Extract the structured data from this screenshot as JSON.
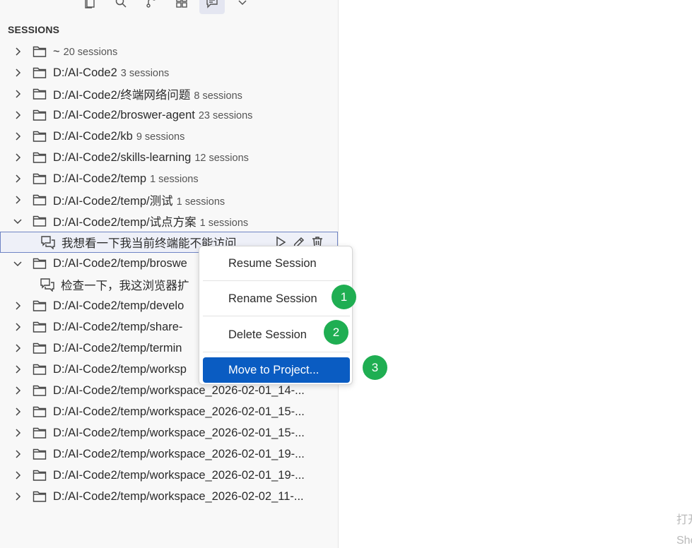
{
  "toolbar": {
    "icons": [
      "explorer-icon",
      "search-icon",
      "source-control-icon",
      "extensions-icon",
      "chat-sessions-icon",
      "chevron-down-icon"
    ]
  },
  "sidebar": {
    "title": "SESSIONS",
    "rows": [
      {
        "label": "~",
        "count": "20 sessions",
        "expanded": false
      },
      {
        "label": "D:/AI-Code2",
        "count": "3 sessions",
        "expanded": false
      },
      {
        "label": "D:/AI-Code2/终端网络问题",
        "count": "8 sessions",
        "expanded": false
      },
      {
        "label": "D:/AI-Code2/broswer-agent",
        "count": "23 sessions",
        "expanded": false
      },
      {
        "label": "D:/AI-Code2/kb",
        "count": "9 sessions",
        "expanded": false
      },
      {
        "label": "D:/AI-Code2/skills-learning",
        "count": "12 sessions",
        "expanded": false
      },
      {
        "label": "D:/AI-Code2/temp",
        "count": "1 sessions",
        "expanded": false
      },
      {
        "label": "D:/AI-Code2/temp/测试",
        "count": "1 sessions",
        "expanded": false
      },
      {
        "label": "D:/AI-Code2/temp/试点方案",
        "count": "1 sessions",
        "expanded": true
      },
      {
        "label": "我想看一下我当前终端能不能访问",
        "session": true,
        "selected": true
      },
      {
        "label": "D:/AI-Code2/temp/broswe",
        "count": "",
        "expanded": true
      },
      {
        "label": "检查一下，我这浏览器扩",
        "session": true
      },
      {
        "label": "D:/AI-Code2/temp/develo",
        "count": "",
        "expanded": false
      },
      {
        "label": "D:/AI-Code2/temp/share-",
        "count": "",
        "expanded": false
      },
      {
        "label": "D:/AI-Code2/temp/termin",
        "count": "",
        "expanded": false
      },
      {
        "label": "D:/AI-Code2/temp/worksp",
        "count": "",
        "expanded": false
      },
      {
        "label": "D:/AI-Code2/temp/workspace_2026-02-01_14-...",
        "count": "",
        "expanded": false
      },
      {
        "label": "D:/AI-Code2/temp/workspace_2026-02-01_15-...",
        "count": "",
        "expanded": false
      },
      {
        "label": "D:/AI-Code2/temp/workspace_2026-02-01_15-...",
        "count": "",
        "expanded": false
      },
      {
        "label": "D:/AI-Code2/temp/workspace_2026-02-01_19-...",
        "count": "",
        "expanded": false
      },
      {
        "label": "D:/AI-Code2/temp/workspace_2026-02-01_19-...",
        "count": "",
        "expanded": false
      },
      {
        "label": "D:/AI-Code2/temp/workspace_2026-02-02_11-...",
        "count": "",
        "expanded": false
      }
    ]
  },
  "context_menu": {
    "items": [
      {
        "label": "Resume Session"
      },
      {
        "label": "Rename Session"
      },
      {
        "label": "Delete Session"
      },
      {
        "label": "Move to Project...",
        "highlighted": true
      }
    ]
  },
  "badges": [
    "1",
    "2",
    "3"
  ],
  "corner_text": [
    "打开",
    "Sho"
  ],
  "colors": {
    "selection_border": "#6f84c4",
    "menu_highlight": "#0a5cc2",
    "badge": "#1fae52"
  }
}
